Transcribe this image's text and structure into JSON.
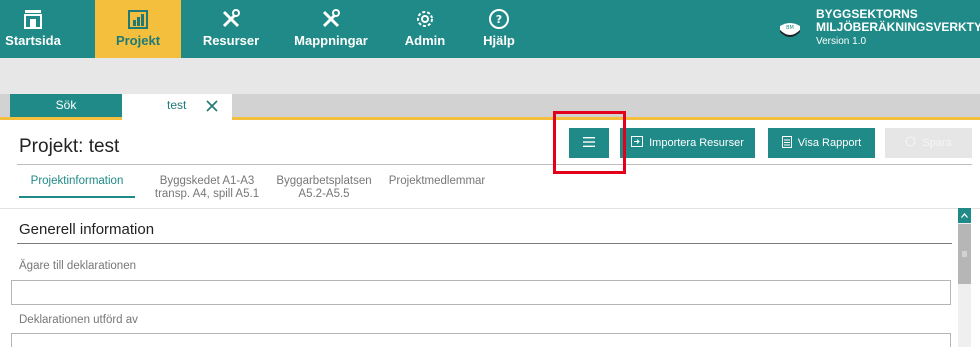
{
  "nav": {
    "items": [
      {
        "label": "Startsida",
        "icon": "home-icon"
      },
      {
        "label": "Projekt",
        "icon": "project-icon"
      },
      {
        "label": "Resurser",
        "icon": "tools-icon"
      },
      {
        "label": "Mappningar",
        "icon": "tools-icon"
      },
      {
        "label": "Admin",
        "icon": "gear-icon"
      },
      {
        "label": "Hjälp",
        "icon": "help-icon"
      }
    ],
    "active": "Projekt"
  },
  "brand": {
    "line1": "BYGGSEKTORNS",
    "line2": "MILJÖBERÄKNINGSVERKTYG",
    "version": "Version 1.0",
    "logo_text": "BM"
  },
  "tabs": {
    "search": "Sök",
    "open_project": "test"
  },
  "project": {
    "title": "Projekt: test"
  },
  "toolbar": {
    "menu_icon": "hamburger-icon",
    "import_label": "Importera Resurser",
    "report_label": "Visa Rapport",
    "save_label": "Spara"
  },
  "subtabs": [
    {
      "line1": "Projektinformation",
      "line2": ""
    },
    {
      "line1": "Byggskedet A1-A3",
      "line2": "transp. A4, spill A5.1"
    },
    {
      "line1": "Byggarbetsplatsen",
      "line2": "A5.2-A5.5"
    },
    {
      "line1": "Projektmedlemmar",
      "line2": ""
    }
  ],
  "section": {
    "title": "Generell information",
    "fields": [
      {
        "label": "Ägare till deklarationen",
        "value": ""
      },
      {
        "label": "Deklarationen utförd av",
        "value": ""
      }
    ]
  },
  "colors": {
    "primary": "#1f8a87",
    "accent": "#f3bf3c",
    "highlight": "#e3001b"
  }
}
